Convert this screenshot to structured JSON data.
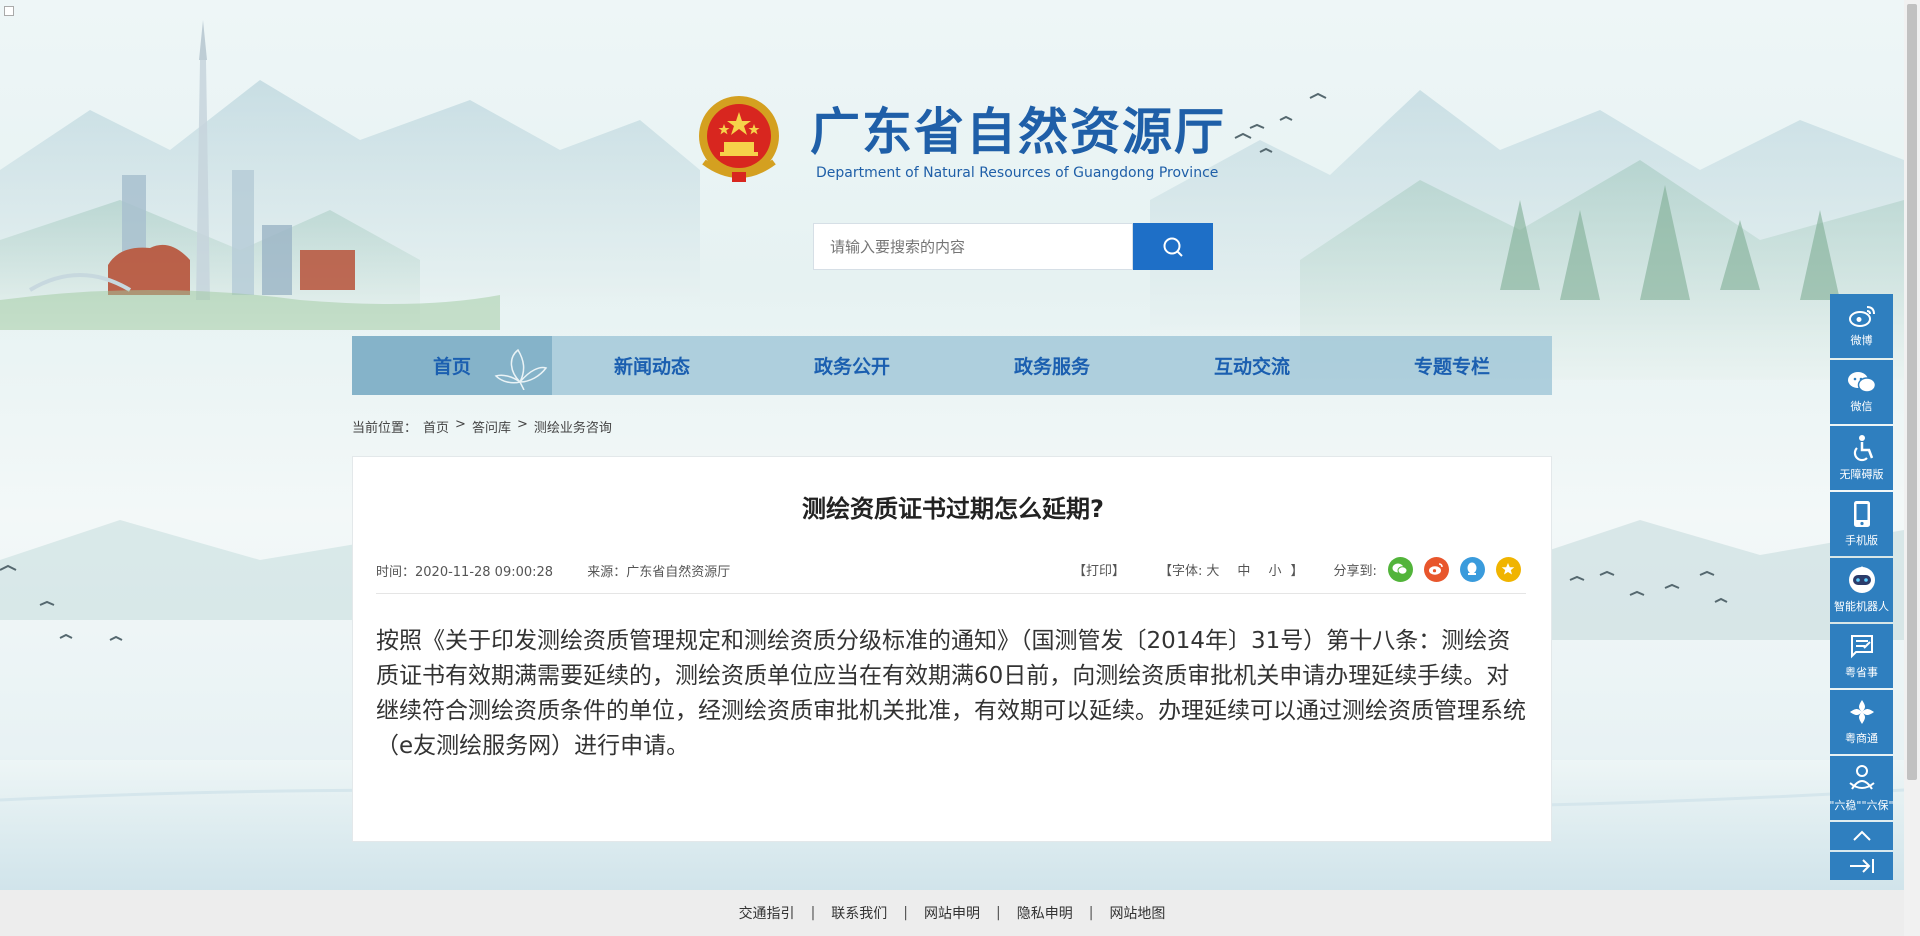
{
  "header": {
    "title": "广东省自然资源厅",
    "subtitle": "Department of Natural Resources of Guangdong Province"
  },
  "search": {
    "placeholder": "请输入要搜索的内容"
  },
  "nav": {
    "items": [
      {
        "label": "首页",
        "active": true
      },
      {
        "label": "新闻动态"
      },
      {
        "label": "政务公开"
      },
      {
        "label": "政务服务"
      },
      {
        "label": "互动交流"
      },
      {
        "label": "专题专栏"
      }
    ]
  },
  "breadcrumb": {
    "prefix": "当前位置：",
    "items": [
      "首页",
      "答问库",
      "测绘业务咨询"
    ],
    "separator": ">"
  },
  "article": {
    "title": "测绘资质证书过期怎么延期?",
    "time": "时间：2020-11-28 09:00:28",
    "source": "来源：广东省自然资源厅",
    "print": "【打印】",
    "font_label": "【字体:",
    "font_large": "大",
    "font_medium": "中",
    "font_small": "小",
    "font_close": "】",
    "share_label": "分享到:",
    "body": "按照《关于印发测绘资质管理规定和测绘资质分级标准的通知》（国测管发〔2014年〕31号）第十八条：测绘资质证书有效期满需要延续的，测绘资质单位应当在有效期满60日前，向测绘资质审批机关申请办理延续手续。对继续符合测绘资质条件的单位，经测绘资质审批机关批准，有效期可以延续。办理延续可以通过测绘资质管理系统（e友测绘服务网）进行申请。"
  },
  "float_bar": {
    "items": [
      {
        "label": "微博",
        "icon": "weibo-icon"
      },
      {
        "label": "微信",
        "icon": "wechat-icon"
      },
      {
        "label": "无障碍版",
        "icon": "accessibility-icon"
      },
      {
        "label": "手机版",
        "icon": "mobile-icon"
      },
      {
        "label": "智能机器人",
        "icon": "robot-icon"
      },
      {
        "label": "粤省事",
        "icon": "yueshengshi-icon"
      },
      {
        "label": "粤商通",
        "icon": "yueshangtong-icon"
      },
      {
        "label": "\"六稳\"\"六保\"",
        "icon": "liuwen-icon"
      }
    ]
  },
  "footer": {
    "links": [
      "交通指引",
      "联系我们",
      "网站申明",
      "隐私申明",
      "网站地图"
    ]
  },
  "colors": {
    "brand_blue": "#1f5fa8",
    "search_button": "#1e6fc7",
    "nav_bg": "#9cc4d6",
    "float_bar": "#2f7fbf",
    "share_wechat": "#52b43a",
    "share_weibo": "#e8562c",
    "share_qq": "#3a9bdc",
    "share_fav": "#f0b400"
  }
}
